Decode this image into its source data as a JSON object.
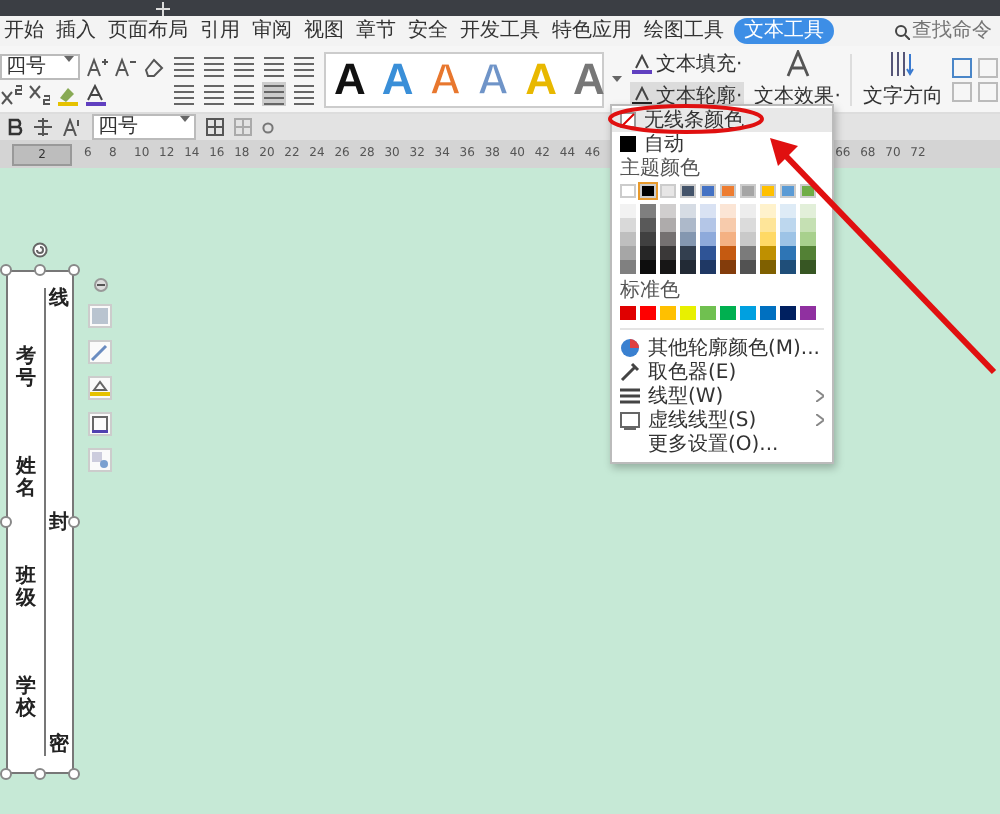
{
  "tabs": [
    {
      "label": "开始",
      "selected": false
    },
    {
      "label": "插入",
      "selected": false
    },
    {
      "label": "页面布局",
      "selected": false
    },
    {
      "label": "引用",
      "selected": false
    },
    {
      "label": "审阅",
      "selected": false
    },
    {
      "label": "视图",
      "selected": false
    },
    {
      "label": "章节",
      "selected": false
    },
    {
      "label": "安全",
      "selected": false
    },
    {
      "label": "开发工具",
      "selected": false
    },
    {
      "label": "特色应用",
      "selected": false
    },
    {
      "label": "绘图工具",
      "selected": false
    },
    {
      "label": "文本工具",
      "selected": true
    }
  ],
  "search": {
    "placeholder": "查找命令"
  },
  "ribbon": {
    "font_size": "四号",
    "styles": [
      {
        "text": "A",
        "kind": "solid",
        "color": "#111111"
      },
      {
        "text": "A",
        "kind": "solid",
        "color": "#3a8fd8"
      },
      {
        "text": "A",
        "kind": "outline",
        "color": "#e8772e"
      },
      {
        "text": "A",
        "kind": "outline",
        "color": "#6f94c8"
      },
      {
        "text": "A",
        "kind": "solid",
        "color": "#e8b800"
      },
      {
        "text": "A",
        "kind": "solid",
        "color": "#777777"
      }
    ],
    "text_fill": "文本填充·",
    "text_outline": "文本轮廓·",
    "text_effect": "文本效果·",
    "text_direction": "文字方向"
  },
  "toolbar": {
    "font_size": "四号"
  },
  "ruler": {
    "first": "2",
    "ticks": [
      "6",
      "8",
      "10",
      "12",
      "14",
      "16",
      "18",
      "20",
      "22",
      "24",
      "26",
      "28",
      "30",
      "32",
      "34",
      "36",
      "38",
      "40",
      "42",
      "44",
      "46",
      "66",
      "68",
      "70",
      "72"
    ]
  },
  "text_box": {
    "labels": [
      "考号",
      "姓名",
      "班级",
      "学校"
    ],
    "marks": [
      "线",
      "封",
      "密"
    ]
  },
  "dropdown": {
    "no_line": {
      "label": "无线条颜色",
      "selected": true
    },
    "auto": {
      "label": "自动",
      "selected": false
    },
    "theme_heading": "主题颜色",
    "theme_top": [
      {
        "color": "#ffffff",
        "selected": false
      },
      {
        "color": "#000000",
        "selected": true
      },
      {
        "color": "#e7e6e6",
        "selected": false
      },
      {
        "color": "#44546a",
        "selected": false
      },
      {
        "color": "#4472c4",
        "selected": false
      },
      {
        "color": "#ed7d31",
        "selected": false
      },
      {
        "color": "#a5a5a5",
        "selected": false
      },
      {
        "color": "#ffc000",
        "selected": false
      },
      {
        "color": "#5b9bd5",
        "selected": false
      },
      {
        "color": "#70ad47",
        "selected": false
      }
    ],
    "theme_shades": [
      [
        {
          "color": "#f2f2f2"
        },
        {
          "color": "#7f7f7f"
        },
        {
          "color": "#d0cece"
        },
        {
          "color": "#d6dce4"
        },
        {
          "color": "#d9e2f3"
        },
        {
          "color": "#fbe5d5"
        },
        {
          "color": "#ededed"
        },
        {
          "color": "#fff2cc"
        },
        {
          "color": "#deebf6"
        },
        {
          "color": "#e2efd9"
        }
      ],
      [
        {
          "color": "#d9d9d9"
        },
        {
          "color": "#595959"
        },
        {
          "color": "#aeabab"
        },
        {
          "color": "#adb9ca"
        },
        {
          "color": "#b4c6e7"
        },
        {
          "color": "#f7cbac"
        },
        {
          "color": "#dbdbdb"
        },
        {
          "color": "#fee599"
        },
        {
          "color": "#bdd7ee"
        },
        {
          "color": "#c5e0b3"
        }
      ],
      [
        {
          "color": "#bfbfbf"
        },
        {
          "color": "#404040"
        },
        {
          "color": "#757171"
        },
        {
          "color": "#8497b0"
        },
        {
          "color": "#8eaadb"
        },
        {
          "color": "#f4b183"
        },
        {
          "color": "#c9c9c9"
        },
        {
          "color": "#ffd965"
        },
        {
          "color": "#9dc3e6"
        },
        {
          "color": "#a8d08d"
        }
      ],
      [
        {
          "color": "#a6a6a6"
        },
        {
          "color": "#262626"
        },
        {
          "color": "#3a3838"
        },
        {
          "color": "#333f4f"
        },
        {
          "color": "#2f5496"
        },
        {
          "color": "#c55a11"
        },
        {
          "color": "#7b7b7b"
        },
        {
          "color": "#bf9000"
        },
        {
          "color": "#2e75b5"
        },
        {
          "color": "#538135"
        }
      ],
      [
        {
          "color": "#808080"
        },
        {
          "color": "#0d0d0d"
        },
        {
          "color": "#171616"
        },
        {
          "color": "#222a35"
        },
        {
          "color": "#1f3864"
        },
        {
          "color": "#833c0b"
        },
        {
          "color": "#525252"
        },
        {
          "color": "#7f6000"
        },
        {
          "color": "#1f4e79"
        },
        {
          "color": "#375623"
        }
      ]
    ],
    "standard_heading": "标准色",
    "standard": [
      {
        "color": "#e00000"
      },
      {
        "color": "#ff0000"
      },
      {
        "color": "#ffc000"
      },
      {
        "color": "#e8f000"
      },
      {
        "color": "#70c050"
      },
      {
        "color": "#00b050"
      },
      {
        "color": "#00a0e0"
      },
      {
        "color": "#0070c0"
      },
      {
        "color": "#002060"
      },
      {
        "color": "#9030a0"
      }
    ],
    "items": [
      {
        "kind": "palette",
        "label": "其他轮廓颜色(M)...",
        "submenu": false,
        "selected": false
      },
      {
        "kind": "picker",
        "label": "取色器(E)",
        "submenu": false,
        "selected": false
      },
      {
        "kind": "line",
        "label": "线型(W)",
        "submenu": true,
        "selected": false
      },
      {
        "kind": "dash",
        "label": "虚线线型(S)",
        "submenu": true,
        "selected": false
      },
      {
        "kind": "plain",
        "label": "更多设置(O)...",
        "submenu": false,
        "selected": false
      }
    ]
  }
}
